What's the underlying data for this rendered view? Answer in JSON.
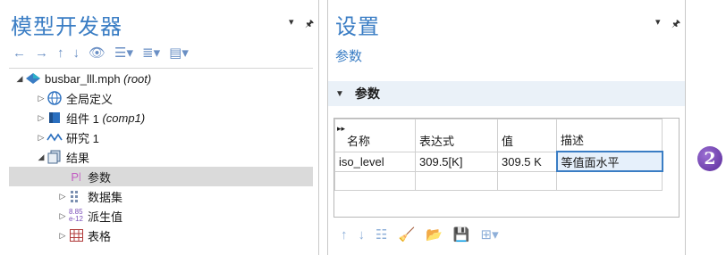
{
  "model_builder": {
    "title": "模型开发器",
    "toolbar_icons": [
      "back-arrow-icon",
      "forward-arrow-icon",
      "move-up-icon",
      "move-down-icon",
      "show-icon",
      "expand-menu-icon",
      "collapse-menu-icon",
      "view-menu-icon"
    ],
    "tree": [
      {
        "label": "busbar_lll.mph",
        "suffix": "(root)",
        "level": 0,
        "expanded": true,
        "icon": "model-diamond-icon"
      },
      {
        "label": "全局定义",
        "suffix": "",
        "level": 1,
        "expanded": false,
        "icon": "globe-icon"
      },
      {
        "label": "组件 1",
        "suffix": "(comp1)",
        "level": 1,
        "expanded": false,
        "icon": "component-icon"
      },
      {
        "label": "研究 1",
        "suffix": "",
        "level": 1,
        "expanded": false,
        "icon": "study-icon"
      },
      {
        "label": "结果",
        "suffix": "",
        "level": 1,
        "expanded": true,
        "icon": "results-icon"
      },
      {
        "label": "参数",
        "suffix": "",
        "level": 2,
        "expanded": null,
        "icon": "parameter-icon",
        "selected": true
      },
      {
        "label": "数据集",
        "suffix": "",
        "level": 2,
        "expanded": false,
        "icon": "dataset-icon"
      },
      {
        "label": "派生值",
        "suffix": "",
        "level": 2,
        "expanded": false,
        "icon": "derived-values-icon"
      },
      {
        "label": "表格",
        "suffix": "",
        "level": 2,
        "expanded": false,
        "icon": "table-icon"
      }
    ]
  },
  "settings": {
    "title": "设置",
    "subtitle": "参数",
    "section_label": "参数",
    "columns": [
      "名称",
      "表达式",
      "值",
      "描述"
    ],
    "rows": [
      {
        "name": "iso_level",
        "expression": "309.5[K]",
        "value": "309.5 K",
        "description": "等值面水平"
      }
    ],
    "bottom_toolbar_icons": [
      "move-up-icon",
      "move-down-icon",
      "delete-icon",
      "clear-brush-icon",
      "open-folder-icon",
      "save-icon",
      "column-options-icon"
    ]
  },
  "badge": "2",
  "colors": {
    "accent": "#3a7dc4",
    "section_bg": "#eaf1f8",
    "selected_bg": "#dadada",
    "badge": "#6a3bab"
  }
}
